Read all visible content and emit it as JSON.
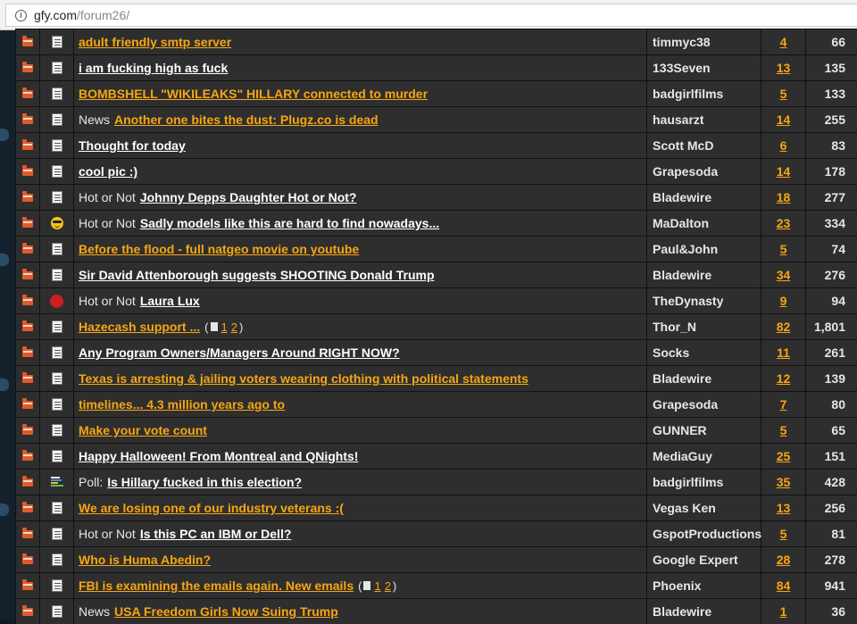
{
  "browser": {
    "url_host": "gfy.com",
    "url_path": "/forum26/"
  },
  "threads": [
    {
      "icon": "doc-icon",
      "prefix": "",
      "title": "adult friendly smtp server",
      "hot": true,
      "user": "timmyc38",
      "replies": "4",
      "views": "66"
    },
    {
      "icon": "doc-icon",
      "prefix": "",
      "title": "i am fucking high as fuck",
      "hot": false,
      "user": "133Seven",
      "replies": "13",
      "views": "135"
    },
    {
      "icon": "doc-icon",
      "prefix": "",
      "title": "BOMBSHELL \"WIKILEAKS\" HILLARY connected to murder",
      "hot": true,
      "user": "badgirlfilms",
      "replies": "5",
      "views": "133"
    },
    {
      "icon": "doc-icon",
      "prefix": "News",
      "title": "Another one bites the dust: Plugz.co is dead",
      "hot": true,
      "user": "hausarzt",
      "replies": "14",
      "views": "255"
    },
    {
      "icon": "doc-icon",
      "prefix": "",
      "title": "Thought for today",
      "hot": false,
      "user": "Scott McD",
      "replies": "6",
      "views": "83"
    },
    {
      "icon": "doc-icon",
      "prefix": "",
      "title": "cool pic :)",
      "hot": false,
      "user": "Grapesoda",
      "replies": "14",
      "views": "178"
    },
    {
      "icon": "doc-icon",
      "prefix": "Hot or Not",
      "title": "Johnny Depps Daughter Hot or Not?",
      "hot": false,
      "user": "Bladewire",
      "replies": "18",
      "views": "277"
    },
    {
      "icon": "smile-icon",
      "prefix": "Hot or Not",
      "title": "Sadly models like this are hard to find nowadays...",
      "hot": false,
      "user": "MaDalton",
      "replies": "23",
      "views": "334"
    },
    {
      "icon": "doc-icon",
      "prefix": "",
      "title": "Before the flood - full natgeo movie on youtube",
      "hot": true,
      "user": "Paul&John",
      "replies": "5",
      "views": "74"
    },
    {
      "icon": "doc-icon",
      "prefix": "",
      "title": "Sir David Attenborough suggests SHOOTING Donald Trump",
      "hot": false,
      "user": "Bladewire",
      "replies": "34",
      "views": "276"
    },
    {
      "icon": "stop-icon",
      "prefix": "Hot or Not",
      "title": "Laura Lux",
      "hot": false,
      "user": "TheDynasty",
      "replies": "9",
      "views": "94"
    },
    {
      "icon": "doc-icon",
      "prefix": "",
      "title": "Hazecash support ...",
      "hot": true,
      "user": "Thor_N",
      "replies": "82",
      "views": "1,801",
      "pages": [
        "1",
        "2"
      ]
    },
    {
      "icon": "doc-icon",
      "prefix": "",
      "title": "Any Program Owners/Managers Around RIGHT NOW?",
      "hot": false,
      "user": "Socks",
      "replies": "11",
      "views": "261"
    },
    {
      "icon": "doc-icon",
      "prefix": "",
      "title": "Texas is arresting & jailing voters wearing clothing with political statements",
      "hot": true,
      "user": "Bladewire",
      "replies": "12",
      "views": "139"
    },
    {
      "icon": "doc-icon",
      "prefix": "",
      "title": "timelines... 4.3 million years ago to",
      "hot": true,
      "user": "Grapesoda",
      "replies": "7",
      "views": "80"
    },
    {
      "icon": "doc-icon",
      "prefix": "",
      "title": "Make your vote count",
      "hot": true,
      "user": "GUNNER",
      "replies": "5",
      "views": "65"
    },
    {
      "icon": "doc-icon",
      "prefix": "",
      "title": "Happy Halloween! From Montreal and QNights!",
      "hot": false,
      "user": "MediaGuy",
      "replies": "25",
      "views": "151"
    },
    {
      "icon": "poll-icon",
      "prefix": "Poll:",
      "title": "Is Hillary fucked in this election?",
      "hot": false,
      "user": "badgirlfilms",
      "replies": "35",
      "views": "428"
    },
    {
      "icon": "doc-icon",
      "prefix": "",
      "title": "We are losing one of our industry veterans :(",
      "hot": true,
      "user": "Vegas Ken",
      "replies": "13",
      "views": "256"
    },
    {
      "icon": "doc-icon",
      "prefix": "Hot or Not",
      "title": "Is this PC an IBM or Dell?",
      "hot": false,
      "user": "GspotProductions",
      "replies": "5",
      "views": "81"
    },
    {
      "icon": "doc-icon",
      "prefix": "",
      "title": "Who is Huma Abedin?",
      "hot": true,
      "user": "Google Expert",
      "replies": "28",
      "views": "278"
    },
    {
      "icon": "doc-icon",
      "prefix": "",
      "title": "FBI is examining the emails again. New emails",
      "hot": true,
      "user": "Phoenix",
      "replies": "84",
      "views": "941",
      "pages": [
        "1",
        "2"
      ]
    },
    {
      "icon": "doc-icon",
      "prefix": "News",
      "title": "USA Freedom Girls Now Suing Trump",
      "hot": true,
      "user": "Bladewire",
      "replies": "1",
      "views": "36"
    }
  ]
}
